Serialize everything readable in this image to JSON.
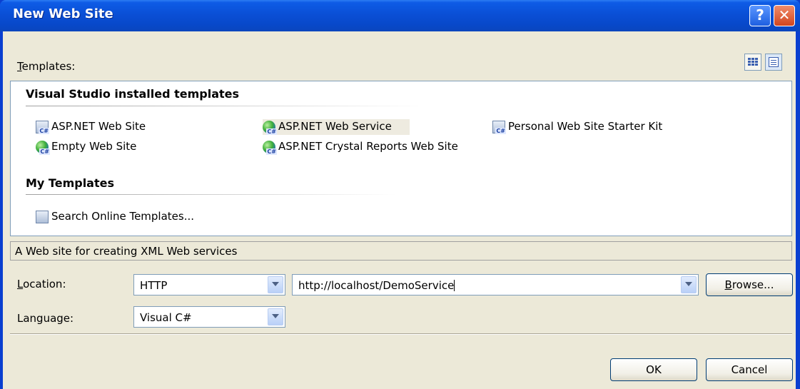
{
  "window": {
    "title": "New Web Site",
    "help_icon": "help-icon",
    "close_icon": "close-icon",
    "colors": {
      "titlebar": "#0a4fd6",
      "client": "#ece9d8",
      "accent_help": "#1e5fe0",
      "accent_close": "#d2451e"
    }
  },
  "templates": {
    "label": "Templates:",
    "label_underline": "T",
    "view_large_icons": "large-icons-view-icon",
    "view_small_icons": "small-icons-view-icon",
    "installed_header": "Visual Studio installed templates",
    "installed_items": [
      {
        "label": "ASP.NET Web Site",
        "icon": "website-icon",
        "selected": false
      },
      {
        "label": "ASP.NET Web Service",
        "icon": "webservice-icon",
        "selected": true
      },
      {
        "label": "Personal Web Site Starter Kit",
        "icon": "starterkit-icon",
        "selected": false
      },
      {
        "label": "Empty Web Site",
        "icon": "empty-website-icon",
        "selected": false
      },
      {
        "label": "ASP.NET Crystal Reports Web Site",
        "icon": "crystal-reports-icon",
        "selected": false
      }
    ],
    "my_header": "My Templates",
    "my_items": [
      {
        "label": "Search Online Templates...",
        "icon": "search-online-icon"
      }
    ]
  },
  "description": "A Web site for creating XML Web services",
  "location": {
    "label": "Location:",
    "type_value": "HTTP",
    "path_value": "http://localhost/DemoService",
    "browse_label": "Browse..."
  },
  "language": {
    "label": "Language:",
    "value": "Visual C#"
  },
  "buttons": {
    "ok": "OK",
    "cancel": "Cancel"
  }
}
